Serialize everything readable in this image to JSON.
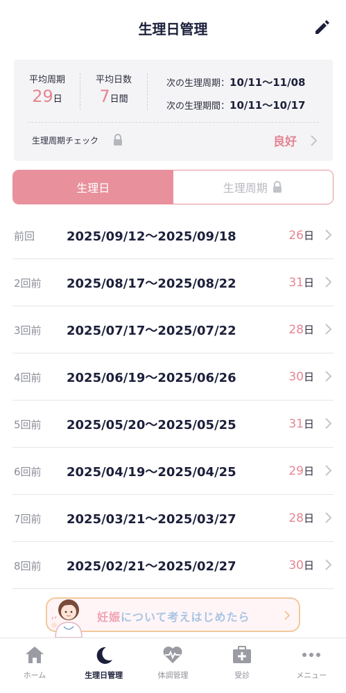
{
  "header": {
    "title": "生理日管理",
    "edit_icon": "pencil-icon"
  },
  "summary": {
    "avg_cycle_label": "平均周期",
    "avg_cycle_value": "29",
    "avg_cycle_unit": "日",
    "avg_days_label": "平均日数",
    "avg_days_value": "7",
    "avg_days_unit": "日間",
    "next_cycle_label": "次の生理周期：",
    "next_cycle_value": "10/11〜11/08",
    "next_period_label": "次の生理期間：",
    "next_period_value": "10/11〜10/17",
    "check_label": "生理周期チェック",
    "check_status": "良好"
  },
  "segment": {
    "active": "生理日",
    "inactive": "生理周期"
  },
  "history": [
    {
      "label": "前回",
      "range": "2025/09/12〜2025/09/18",
      "days": "26",
      "unit": "日"
    },
    {
      "label": "2回前",
      "range": "2025/08/17〜2025/08/22",
      "days": "31",
      "unit": "日"
    },
    {
      "label": "3回前",
      "range": "2025/07/17〜2025/07/22",
      "days": "28",
      "unit": "日"
    },
    {
      "label": "4回前",
      "range": "2025/06/19〜2025/06/26",
      "days": "30",
      "unit": "日"
    },
    {
      "label": "5回前",
      "range": "2025/05/20〜2025/05/25",
      "days": "31",
      "unit": "日"
    },
    {
      "label": "6回前",
      "range": "2025/04/19〜2025/04/25",
      "days": "29",
      "unit": "日"
    },
    {
      "label": "7回前",
      "range": "2025/03/21〜2025/03/27",
      "days": "28",
      "unit": "日"
    },
    {
      "label": "8回前",
      "range": "2025/02/21〜2025/02/27",
      "days": "30",
      "unit": "日"
    }
  ],
  "banner": {
    "text_pink": "妊娠",
    "text_blue": "について考えはじめたら"
  },
  "tabs": [
    {
      "label": "ホーム",
      "icon": "home-icon"
    },
    {
      "label": "生理日管理",
      "icon": "moon-icon"
    },
    {
      "label": "体調管理",
      "icon": "heart-pulse-icon"
    },
    {
      "label": "受診",
      "icon": "medical-kit-icon"
    },
    {
      "label": "メニュー",
      "icon": "more-dots-icon"
    }
  ],
  "colors": {
    "accent": "#e8909c",
    "accent_text": "#e48592",
    "navy": "#1c1f3a",
    "gray": "#8c8e98"
  }
}
